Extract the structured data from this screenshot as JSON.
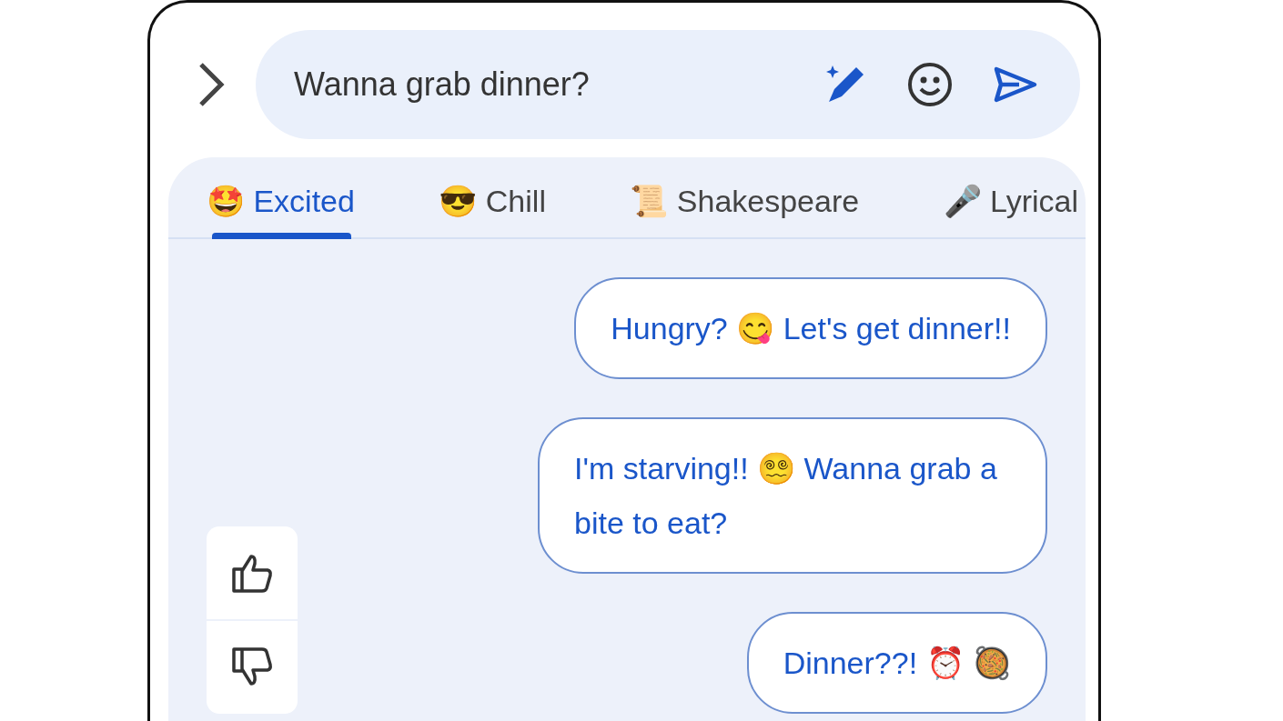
{
  "composer": {
    "value": "Wanna grab dinner?"
  },
  "tabs": [
    {
      "label": "🤩 Excited",
      "selected": true
    },
    {
      "label": "😎 Chill",
      "selected": false
    },
    {
      "label": "📜 Shakespeare",
      "selected": false
    },
    {
      "label": "🎤 Lyrical",
      "selected": false
    }
  ],
  "suggestions": [
    {
      "text": "Hungry? 😋 Let's get dinner!!"
    },
    {
      "text": "I'm starving!! 😵‍💫 Wanna grab a bite to eat?"
    },
    {
      "text": "Dinner??! ⏰ 🥘"
    }
  ]
}
